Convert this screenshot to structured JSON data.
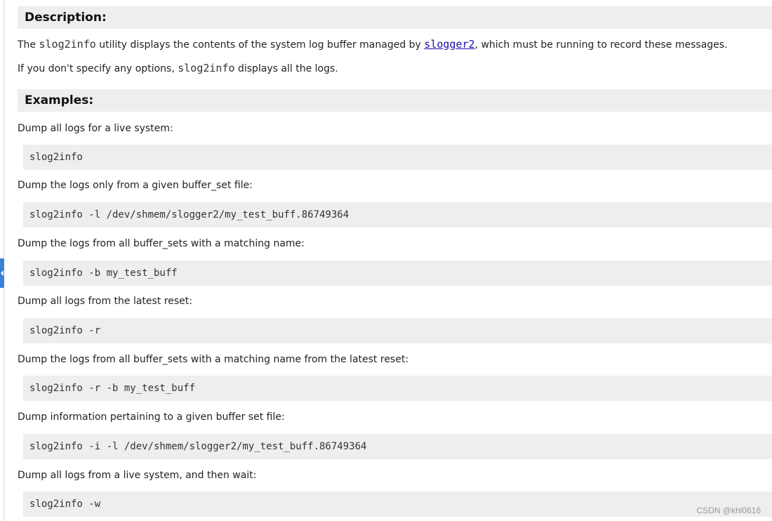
{
  "description": {
    "heading": "Description:",
    "para1": {
      "before": "The ",
      "cmd": "slog2info",
      "middle": " utility displays the contents of the system log buffer managed by ",
      "link": "slogger2",
      "after": ", which must be running to record these messages."
    },
    "para2": {
      "before": "If you don't specify any options, ",
      "cmd": "slog2info",
      "after": " displays all the logs."
    }
  },
  "examples": {
    "heading": "Examples:",
    "items": [
      {
        "text": "Dump all logs for a live system:",
        "code": "slog2info"
      },
      {
        "text": "Dump the logs only from a given buffer_set file:",
        "code": "slog2info -l /dev/shmem/slogger2/my_test_buff.86749364"
      },
      {
        "text": "Dump the logs from all buffer_sets with a matching name:",
        "code": "slog2info -b my_test_buff"
      },
      {
        "text": "Dump all logs from the latest reset:",
        "code": "slog2info -r"
      },
      {
        "text": "Dump the logs from all buffer_sets with a matching name from the latest reset:",
        "code": "slog2info -r -b my_test_buff"
      },
      {
        "text": "Dump information pertaining to a given buffer set file:",
        "code": "slog2info -i -l /dev/shmem/slogger2/my_test_buff.86749364"
      },
      {
        "text": "Dump all logs from a live system, and then wait:",
        "code": "slog2info -w"
      }
    ]
  },
  "watermark": "CSDN @khl0616",
  "icons": {
    "collapse": "collapse-left-icon"
  },
  "colors": {
    "heading_bg": "#eeeeee",
    "code_bg": "#eeeeee",
    "link": "#1a0dab",
    "tab": "#3b82d6"
  }
}
